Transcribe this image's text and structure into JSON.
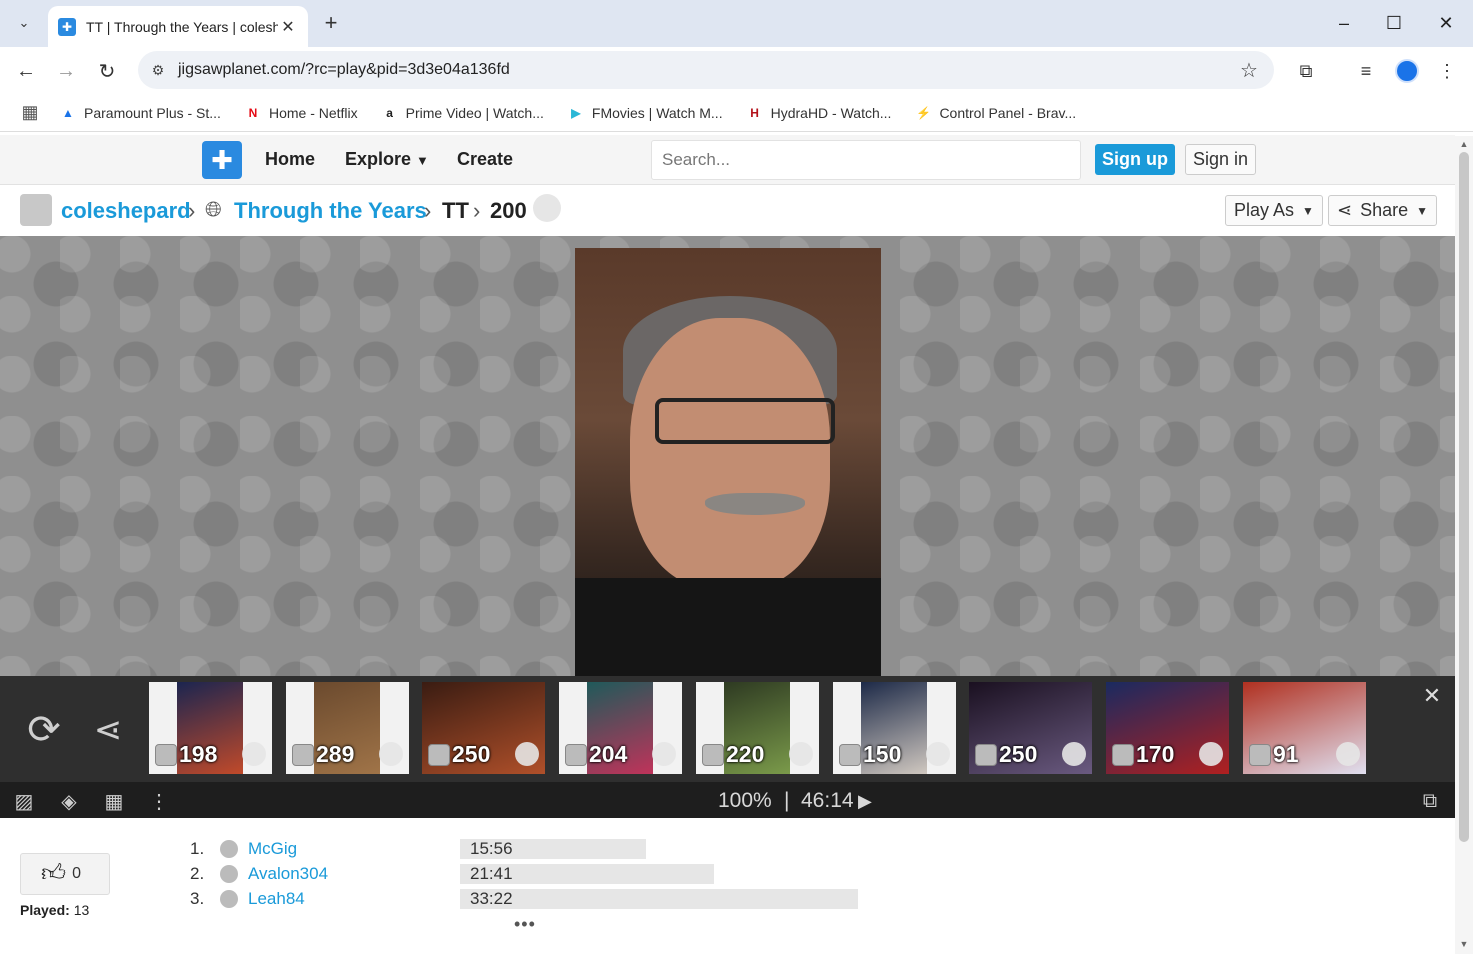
{
  "browser": {
    "tab_title": "TT | Through the Years | coleshepard",
    "url": "jigsawplanet.com/?rc=play&pid=3d3e04a136fd",
    "bookmarks": [
      {
        "label": "Paramount Plus - St...",
        "icon": "paramount-icon",
        "color": "#1a73e8"
      },
      {
        "label": "Home - Netflix",
        "icon": "netflix-icon",
        "color": "#e50914"
      },
      {
        "label": "Prime Video | Watch...",
        "icon": "amazon-icon",
        "color": "#222222"
      },
      {
        "label": "FMovies | Watch M...",
        "icon": "fmovies-icon",
        "color": "#2bb7d6"
      },
      {
        "label": "HydraHD - Watch...",
        "icon": "hydrahd-icon",
        "color": "#b3121b"
      },
      {
        "label": "Control Panel - Brav...",
        "icon": "bolt-icon",
        "color": "#f2b01e"
      }
    ]
  },
  "site": {
    "nav": {
      "home": "Home",
      "explore": "Explore",
      "create": "Create"
    },
    "search_placeholder": "Search...",
    "signup": "Sign up",
    "signin": "Sign in"
  },
  "breadcrumb": {
    "user": "coleshepard",
    "album": "Through the Years",
    "folder": "TT",
    "pieces": "200",
    "play_as": "Play As",
    "share": "Share"
  },
  "thumbnails": [
    {
      "count": "198",
      "colors": [
        "#1b2550",
        "#c14a2a"
      ]
    },
    {
      "count": "289",
      "colors": [
        "#6b4a2e",
        "#a07448"
      ]
    },
    {
      "count": "250",
      "colors": [
        "#3a1c12",
        "#b0502a"
      ]
    },
    {
      "count": "204",
      "colors": [
        "#1f5a5a",
        "#c0335a"
      ]
    },
    {
      "count": "220",
      "colors": [
        "#2e3a22",
        "#7a9a4a"
      ]
    },
    {
      "count": "150",
      "colors": [
        "#1d2a48",
        "#d0c8c0"
      ]
    },
    {
      "count": "250",
      "colors": [
        "#1a1020",
        "#6a5a80"
      ]
    },
    {
      "count": "170",
      "colors": [
        "#1a2a60",
        "#b02020"
      ]
    },
    {
      "count": "91",
      "colors": [
        "#b03020",
        "#e0e0f0"
      ]
    }
  ],
  "controls": {
    "zoom": "100%",
    "separator": "|",
    "timer": "46:14"
  },
  "likes": "0",
  "played_label": "Played:",
  "played_count": "13",
  "leaderboard": [
    {
      "rank": "1.",
      "name": "McGig",
      "time": "15:56",
      "bar": 0.35
    },
    {
      "rank": "2.",
      "name": "Avalon304",
      "time": "21:41",
      "bar": 0.48
    },
    {
      "rank": "3.",
      "name": "Leah84",
      "time": "33:22",
      "bar": 0.75
    }
  ],
  "more": "•••"
}
